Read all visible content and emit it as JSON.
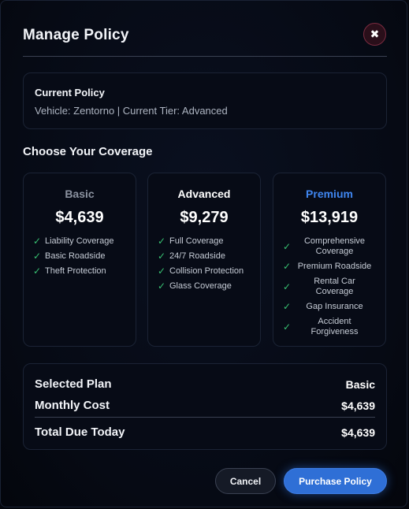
{
  "modal": {
    "title": "Manage Policy",
    "close_label": "✖"
  },
  "current_policy": {
    "heading": "Current Policy",
    "detail": "Vehicle: Zentorno | Current Tier: Advanced"
  },
  "coverage": {
    "heading": "Choose Your Coverage",
    "check_glyph": "✓",
    "plans": [
      {
        "name": "Basic",
        "price": "$4,639",
        "name_color": "#8b92a0",
        "features": [
          "Liability Coverage",
          "Basic Roadside",
          "Theft Protection"
        ]
      },
      {
        "name": "Advanced",
        "price": "$9,279",
        "name_color": "#ffffff",
        "features": [
          "Full Coverage",
          "24/7 Roadside",
          "Collision Protection",
          "Glass Coverage"
        ]
      },
      {
        "name": "Premium",
        "price": "$13,919",
        "name_color": "#3f86f0",
        "features": [
          "Comprehensive Coverage",
          "Premium Roadside",
          "Rental Car Coverage",
          "Gap Insurance",
          "Accident Forgiveness"
        ]
      }
    ]
  },
  "summary": {
    "selected_plan_label": "Selected Plan",
    "selected_plan_value": "Basic",
    "monthly_cost_label": "Monthly Cost",
    "monthly_cost_value": "$4,639",
    "total_label": "Total Due Today",
    "total_value": "$4,639"
  },
  "actions": {
    "cancel_label": "Cancel",
    "purchase_label": "Purchase Policy"
  },
  "colors": {
    "accent": "#2f6fd6",
    "check": "#38c172",
    "close_border": "#7a2b40"
  }
}
